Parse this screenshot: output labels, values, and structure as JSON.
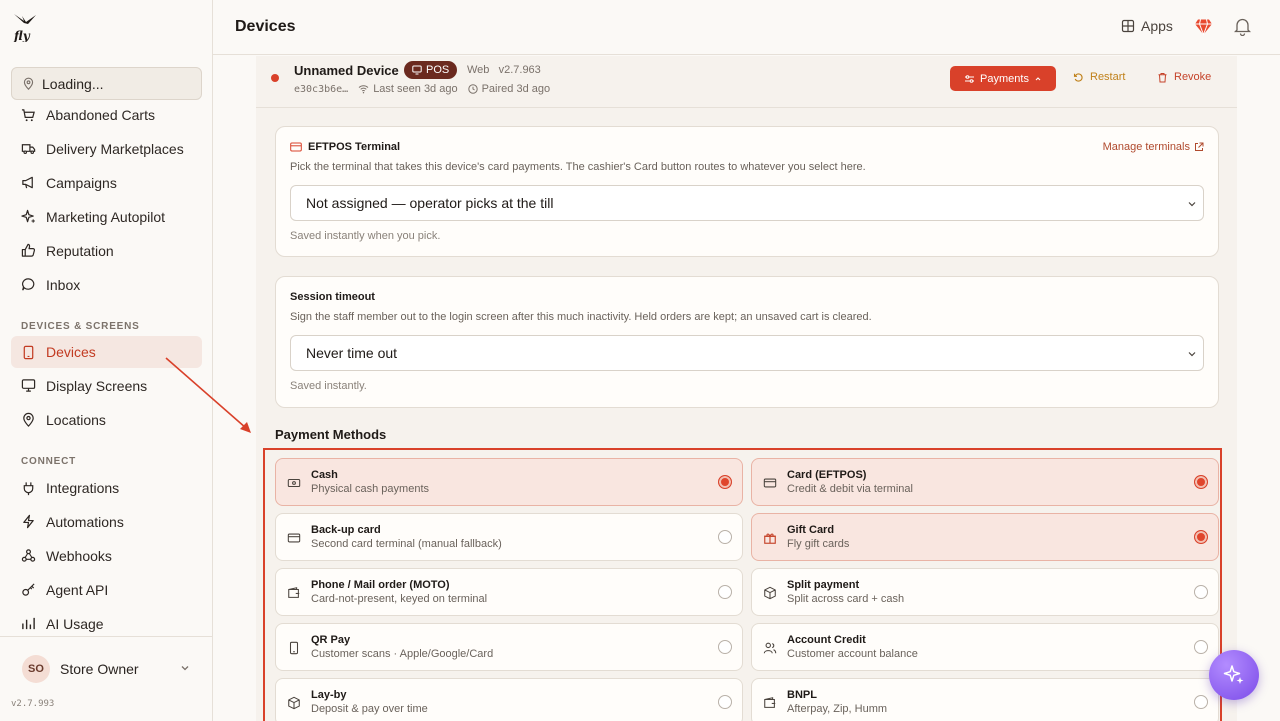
{
  "app": {
    "logo_text": "fly",
    "version": "v2.7.993"
  },
  "header": {
    "title": "Devices",
    "apps_label": "Apps"
  },
  "sidebar": {
    "location_select": "Loading...",
    "items_top": [
      {
        "label": "Abandoned Carts",
        "icon": "cart-icon"
      },
      {
        "label": "Delivery Marketplaces",
        "icon": "truck-icon"
      },
      {
        "label": "Campaigns",
        "icon": "megaphone-icon"
      },
      {
        "label": "Marketing Autopilot",
        "icon": "sparkle-icon"
      },
      {
        "label": "Reputation",
        "icon": "thumbs-up-icon"
      },
      {
        "label": "Inbox",
        "icon": "chat-icon"
      }
    ],
    "section_devices": "DEVICES & SCREENS",
    "items_devices": [
      {
        "label": "Devices",
        "icon": "tablet-icon",
        "active": true
      },
      {
        "label": "Display Screens",
        "icon": "monitor-icon"
      },
      {
        "label": "Locations",
        "icon": "pin-icon"
      }
    ],
    "section_connect": "CONNECT",
    "items_connect": [
      {
        "label": "Integrations",
        "icon": "plug-icon"
      },
      {
        "label": "Automations",
        "icon": "bolt-icon"
      },
      {
        "label": "Webhooks",
        "icon": "webhook-icon"
      },
      {
        "label": "Agent API",
        "icon": "key-icon"
      },
      {
        "label": "AI Usage",
        "icon": "chart-icon"
      }
    ],
    "user": {
      "initials": "SO",
      "name": "Store Owner"
    }
  },
  "device": {
    "name": "Unnamed Device",
    "badge": "POS",
    "platform": "Web",
    "version": "v2.7.963",
    "id_short": "e30c3b6e…",
    "last_seen": "Last seen 3d ago",
    "paired": "Paired 3d ago",
    "payments_button": "Payments",
    "restart_button": "Restart",
    "revoke_button": "Revoke",
    "status_color": "#d9412a"
  },
  "eftpos": {
    "title": "EFTPOS Terminal",
    "description": "Pick the terminal that takes this device's card payments. The cashier's Card button routes to whatever you select here.",
    "manage_link": "Manage terminals",
    "selected": "Not assigned — operator picks at the till",
    "hint": "Saved instantly when you pick."
  },
  "session": {
    "title": "Session timeout",
    "description": "Sign the staff member out to the login screen after this much inactivity. Held orders are kept; an unsaved cart is cleared.",
    "selected": "Never time out",
    "hint": "Saved instantly."
  },
  "payment_methods": {
    "heading": "Payment Methods",
    "items": [
      {
        "title": "Cash",
        "subtitle": "Physical cash payments",
        "enabled": true,
        "icon": "cash-icon"
      },
      {
        "title": "Card (EFTPOS)",
        "subtitle": "Credit & debit via terminal",
        "enabled": true,
        "icon": "card-icon"
      },
      {
        "title": "Back-up card",
        "subtitle": "Second card terminal (manual fallback)",
        "enabled": false,
        "icon": "card-icon"
      },
      {
        "title": "Gift Card",
        "subtitle": "Fly gift cards",
        "enabled": true,
        "icon": "gift-icon"
      },
      {
        "title": "Phone / Mail order (MOTO)",
        "subtitle": "Card-not-present, keyed on terminal",
        "enabled": false,
        "icon": "wallet-icon"
      },
      {
        "title": "Split payment",
        "subtitle": "Split across card + cash",
        "enabled": false,
        "icon": "box-icon"
      },
      {
        "title": "QR Pay",
        "subtitle": "Customer scans · Apple/Google/Card",
        "enabled": false,
        "icon": "phone-icon"
      },
      {
        "title": "Account Credit",
        "subtitle": "Customer account balance",
        "enabled": false,
        "icon": "users-icon"
      },
      {
        "title": "Lay-by",
        "subtitle": "Deposit & pay over time",
        "enabled": false,
        "icon": "box-icon"
      },
      {
        "title": "BNPL",
        "subtitle": "Afterpay, Zip, Humm",
        "enabled": false,
        "icon": "wallet-icon"
      }
    ]
  },
  "colors": {
    "accent": "#d9412a",
    "selected_bg": "#f9e6e0",
    "sidebar_active_bg": "#f5e7e1"
  }
}
